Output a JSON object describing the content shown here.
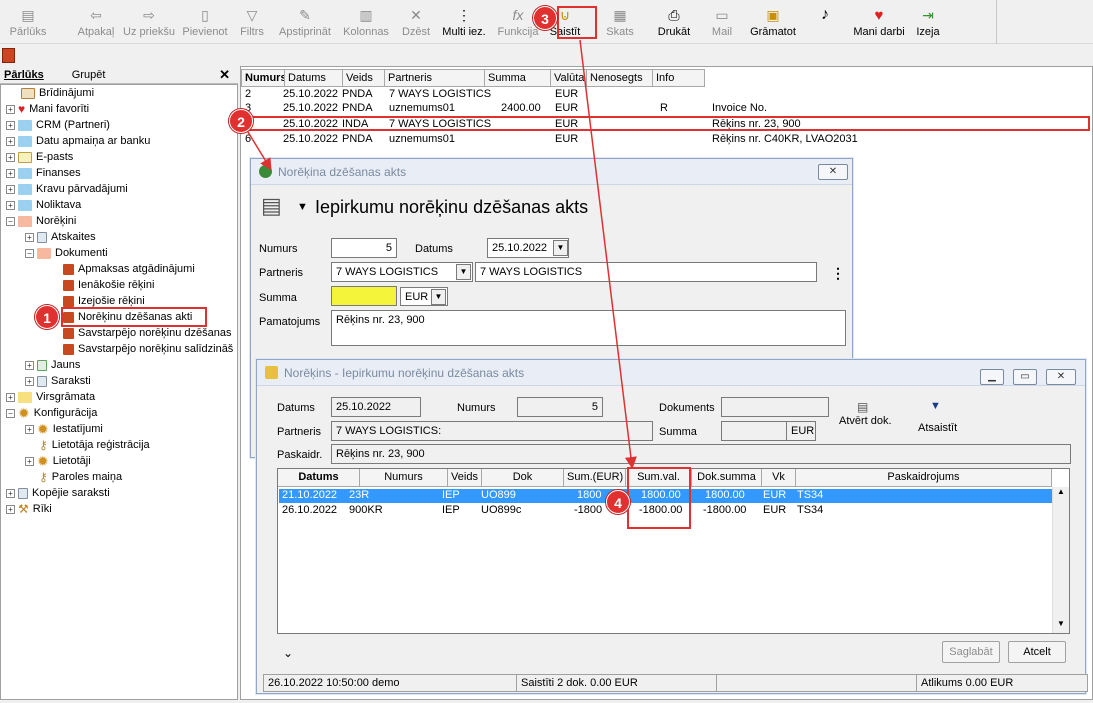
{
  "toolbar": {
    "parluks": "Pārlūks",
    "atpakal": "Atpakaļ",
    "uzpriekshu": "Uz priekšu",
    "pievienot": "Pievienot",
    "filtrs": "Filtrs",
    "apstiprinat": "Apstiprināt",
    "kolonnas": "Kolonnas",
    "dzest": "Dzēst",
    "multi": "Multi iez.",
    "funkcijas": "Funkcija",
    "saistit": "Saistīt",
    "skats": "Skats",
    "drukat": "Drukāt",
    "mail": "Mail",
    "gramatot": "Grāmatot",
    "mani_darbi": "Mani darbi",
    "izeja": "Izeja"
  },
  "left": {
    "tab_browser": "Pārlūks",
    "tab_group": "Grupēt",
    "close": "✕",
    "tree": [
      "Brīdinājumi",
      "Mani favorīti",
      "CRM (Partneri)",
      "Datu apmaiņa ar banku",
      "E-pasts",
      "Finanses",
      "Kravu pārvadājumi",
      "Noliktava",
      "Norēķini",
      "Atskaites",
      "Dokumenti",
      "Apmaksas atgādinājumi",
      "Ienākošie rēķini",
      "Izejošie rēķini",
      "Norēķinu dzēšanas akti",
      "Savstarpējo norēķinu dzēšanas",
      "Savstarpējo norēķinu salīdzināš",
      "Jauns",
      "Saraksti",
      "Virsgrāmata",
      "Konfigurācija",
      "Iestatījumi",
      "Lietotāja reģistrācija",
      "Lietotāji",
      "Paroles maiņa",
      "Kopējie saraksti",
      "Rīki"
    ]
  },
  "list": {
    "columns": [
      "Numurs",
      "Datums",
      "Veids",
      "Partneris",
      "Summa",
      "Valūta",
      "Nenosegts",
      "Info"
    ],
    "rows": [
      {
        "numurs": "2",
        "datums": "25.10.2022",
        "veids": "PNDA",
        "partneris": "7 WAYS LOGISTICS",
        "summa": "",
        "valuta": "EUR",
        "nenosegts": "",
        "info": "",
        "extra": ""
      },
      {
        "numurs": "3",
        "datums": "25.10.2022",
        "veids": "PNDA",
        "partneris": "uznemums01",
        "summa": "2400.00",
        "valuta": "EUR",
        "nenosegts": "",
        "info": "R",
        "extra": "Invoice No."
      },
      {
        "numurs": "5",
        "datums": "25.10.2022",
        "veids": "INDA",
        "partneris": "7 WAYS LOGISTICS",
        "summa": "",
        "valuta": "EUR",
        "nenosegts": "",
        "info": "",
        "extra": "Rēķins nr. 23, 900"
      },
      {
        "numurs": "6",
        "datums": "25.10.2022",
        "veids": "PNDA",
        "partneris": "uznemums01",
        "summa": "",
        "valuta": "EUR",
        "nenosegts": "",
        "info": "",
        "extra": "Rēķins nr. C40KR, LVAO2031"
      }
    ]
  },
  "dialog1": {
    "title": "Norēķina dzēšanas akts",
    "heading": "Iepirkumu norēķinu dzēšanas akts",
    "numurs_label": "Numurs",
    "numurs": "5",
    "datums_label": "Datums",
    "datums": "25.10.2022",
    "partneris_label": "Partneris",
    "partneris_code": "7 WAYS LOGISTICS",
    "partneris_name": "7 WAYS LOGISTICS",
    "summa_label": "Summa",
    "valuta": "EUR",
    "pamatojums_label": "Pamatojums",
    "pamatojums": "Rēķins nr. 23, 900"
  },
  "dialog2": {
    "title": "Norēķins - Iepirkumu norēķinu dzēšanas akts",
    "datums_label": "Datums",
    "datums": "25.10.2022",
    "numurs_label": "Numurs",
    "numurs": "5",
    "dokuments_label": "Dokuments",
    "dokuments": "",
    "partneris_label": "Partneris",
    "partneris": "7 WAYS LOGISTICS:",
    "summa_label": "Summa",
    "summa": "",
    "summa_val": "EUR",
    "paskaidr_label": "Paskaidr.",
    "paskaidr": "Rēķins nr. 23, 900",
    "atvert": "Atvērt dok.",
    "atsaistit": "Atsaistīt",
    "columns": [
      "Datums",
      "Numurs",
      "Veids",
      "Dok",
      "Sum.(EUR)",
      "Sum.val.",
      "Dok.summa",
      "Vk",
      "Paskaidrojums"
    ],
    "rows": [
      {
        "datums": "21.10.2022",
        "numurs": "23R",
        "veids": "IEP",
        "dok": "UO899",
        "sum_eur": "1800",
        "sum_val": "1800.00",
        "dok_summa": "1800.00",
        "vk": "EUR",
        "paskaidrojums": "TS34"
      },
      {
        "datums": "26.10.2022",
        "numurs": "900KR",
        "veids": "IEP",
        "dok": "UO899c",
        "sum_eur": "-1800",
        "sum_val": "-1800.00",
        "dok_summa": "-1800.00",
        "vk": "EUR",
        "paskaidrojums": "TS34"
      }
    ],
    "save": "Saglabāt",
    "cancel": "Atcelt"
  },
  "status": {
    "s1": "26.10.2022 10:50:00 demo",
    "s2": "Saistīti 2 dok. 0.00 EUR",
    "s3": "Atlikums 0.00 EUR"
  },
  "badges": [
    "1",
    "2",
    "3",
    "4"
  ],
  "colors": {
    "accent": "#e03030",
    "selection": "#3399ff",
    "summa_field": "#f4f43a"
  }
}
